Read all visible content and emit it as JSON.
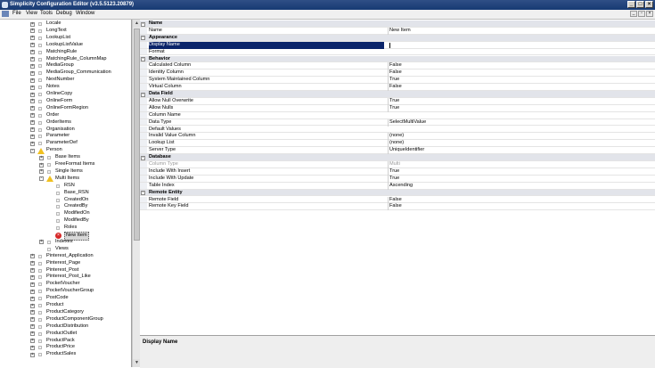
{
  "window": {
    "title": "Simplicity Configuration Editor (v3.5.5123.20879)",
    "controls": [
      "_",
      "□",
      "×"
    ]
  },
  "menu": {
    "items": [
      "File",
      "View",
      "Tools",
      "Debug",
      "Window"
    ]
  },
  "tree": {
    "items": [
      {
        "label": "Locale",
        "level": 0,
        "expander": "+"
      },
      {
        "label": "LongText",
        "level": 0,
        "expander": "+"
      },
      {
        "label": "LookupList",
        "level": 0,
        "expander": "+"
      },
      {
        "label": "LookupListValue",
        "level": 0,
        "expander": "+"
      },
      {
        "label": "MatchingRule",
        "level": 0,
        "expander": "+"
      },
      {
        "label": "MatchingRule_ColumnMap",
        "level": 0,
        "expander": "+"
      },
      {
        "label": "MediaGroup",
        "level": 0,
        "expander": "+"
      },
      {
        "label": "MediaGroup_Communication",
        "level": 0,
        "expander": "+"
      },
      {
        "label": "NextNumber",
        "level": 0,
        "expander": "+"
      },
      {
        "label": "Notes",
        "level": 0,
        "expander": "+"
      },
      {
        "label": "OnlineCopy",
        "level": 0,
        "expander": "+"
      },
      {
        "label": "OnlineForm",
        "level": 0,
        "expander": "+"
      },
      {
        "label": "OnlineFormRegion",
        "level": 0,
        "expander": "+"
      },
      {
        "label": "Order",
        "level": 0,
        "expander": "+"
      },
      {
        "label": "OrderItems",
        "level": 0,
        "expander": "+"
      },
      {
        "label": "Organisation",
        "level": 0,
        "expander": "+"
      },
      {
        "label": "Parameter",
        "level": 0,
        "expander": "+"
      },
      {
        "label": "ParameterDef",
        "level": 0,
        "expander": "+"
      },
      {
        "label": "Person",
        "level": 0,
        "expander": "-",
        "icon": "warning"
      },
      {
        "label": "Base Items",
        "level": 1,
        "expander": "+"
      },
      {
        "label": "FreeFormat Items",
        "level": 1,
        "expander": "+"
      },
      {
        "label": "Single Items",
        "level": 1,
        "expander": "+"
      },
      {
        "label": "Multi Items",
        "level": 1,
        "expander": "-",
        "icon": "warning"
      },
      {
        "label": "RSN",
        "level": 2
      },
      {
        "label": "Base_RSN",
        "level": 2
      },
      {
        "label": "CreatedOn",
        "level": 2
      },
      {
        "label": "CreatedBy",
        "level": 2
      },
      {
        "label": "ModifiedOn",
        "level": 2
      },
      {
        "label": "ModifiedBy",
        "level": 2
      },
      {
        "label": "Roles",
        "level": 2
      },
      {
        "label": "New Item",
        "level": 2,
        "icon": "error",
        "selected": true
      },
      {
        "label": "Indexes",
        "level": 1,
        "expander": "+"
      },
      {
        "label": "Views",
        "level": 1
      },
      {
        "label": "Pinterest_Application",
        "level": 0,
        "expander": "+"
      },
      {
        "label": "Pinterest_Page",
        "level": 0,
        "expander": "+"
      },
      {
        "label": "Pinterest_Post",
        "level": 0,
        "expander": "+"
      },
      {
        "label": "Pinterest_Post_Like",
        "level": 0,
        "expander": "+"
      },
      {
        "label": "PocketVoucher",
        "level": 0,
        "expander": "+"
      },
      {
        "label": "PocketVoucherGroup",
        "level": 0,
        "expander": "+"
      },
      {
        "label": "PostCode",
        "level": 0,
        "expander": "+"
      },
      {
        "label": "Product",
        "level": 0,
        "expander": "+"
      },
      {
        "label": "ProductCategory",
        "level": 0,
        "expander": "+"
      },
      {
        "label": "ProductComponentGroup",
        "level": 0,
        "expander": "+"
      },
      {
        "label": "ProductDistribution",
        "level": 0,
        "expander": "+"
      },
      {
        "label": "ProductOutlet",
        "level": 0,
        "expander": "+"
      },
      {
        "label": "ProductPack",
        "level": 0,
        "expander": "+"
      },
      {
        "label": "ProductPrice",
        "level": 0,
        "expander": "+"
      },
      {
        "label": "ProductSales",
        "level": 0,
        "expander": "+"
      }
    ]
  },
  "properties": {
    "rows": [
      {
        "type": "category",
        "name": "Name"
      },
      {
        "type": "prop",
        "name": "Name",
        "value": "New Item"
      },
      {
        "type": "category",
        "name": "Appearance"
      },
      {
        "type": "prop",
        "name": "Display Name",
        "value": "",
        "selected": true
      },
      {
        "type": "prop",
        "name": "Format",
        "value": ""
      },
      {
        "type": "category",
        "name": "Behavior"
      },
      {
        "type": "prop",
        "name": "Calculated Column",
        "value": "False"
      },
      {
        "type": "prop",
        "name": "Identity Column",
        "value": "False"
      },
      {
        "type": "prop",
        "name": "System Maintained Column",
        "value": "True"
      },
      {
        "type": "prop",
        "name": "Virtual Column",
        "value": "False"
      },
      {
        "type": "category",
        "name": "Data Field"
      },
      {
        "type": "prop",
        "name": "Allow Null Overwrite",
        "value": "True"
      },
      {
        "type": "prop",
        "name": "Allow Nulls",
        "value": "True"
      },
      {
        "type": "prop",
        "name": "Column Name",
        "value": ""
      },
      {
        "type": "prop",
        "name": "Data Type",
        "value": "SelectMultiValue"
      },
      {
        "type": "prop",
        "name": "Default Values",
        "value": ""
      },
      {
        "type": "prop",
        "name": "Invalid Value Column",
        "value": "(none)"
      },
      {
        "type": "prop",
        "name": "Lookup List",
        "value": "(none)"
      },
      {
        "type": "prop",
        "name": "Server Type",
        "value": "UniqueIdentifier"
      },
      {
        "type": "category",
        "name": "Database"
      },
      {
        "type": "prop",
        "name": "Column Type",
        "value": "Multi",
        "dim": true
      },
      {
        "type": "prop",
        "name": "Include With Insert",
        "value": "True"
      },
      {
        "type": "prop",
        "name": "Include With Update",
        "value": "True"
      },
      {
        "type": "prop",
        "name": "Table Index",
        "value": "Ascending"
      },
      {
        "type": "category",
        "name": "Remote Entity"
      },
      {
        "type": "prop",
        "name": "Remote Field",
        "value": "False"
      },
      {
        "type": "prop",
        "name": "Remote Key Field",
        "value": "False"
      }
    ]
  },
  "description": {
    "title": "Display Name"
  }
}
